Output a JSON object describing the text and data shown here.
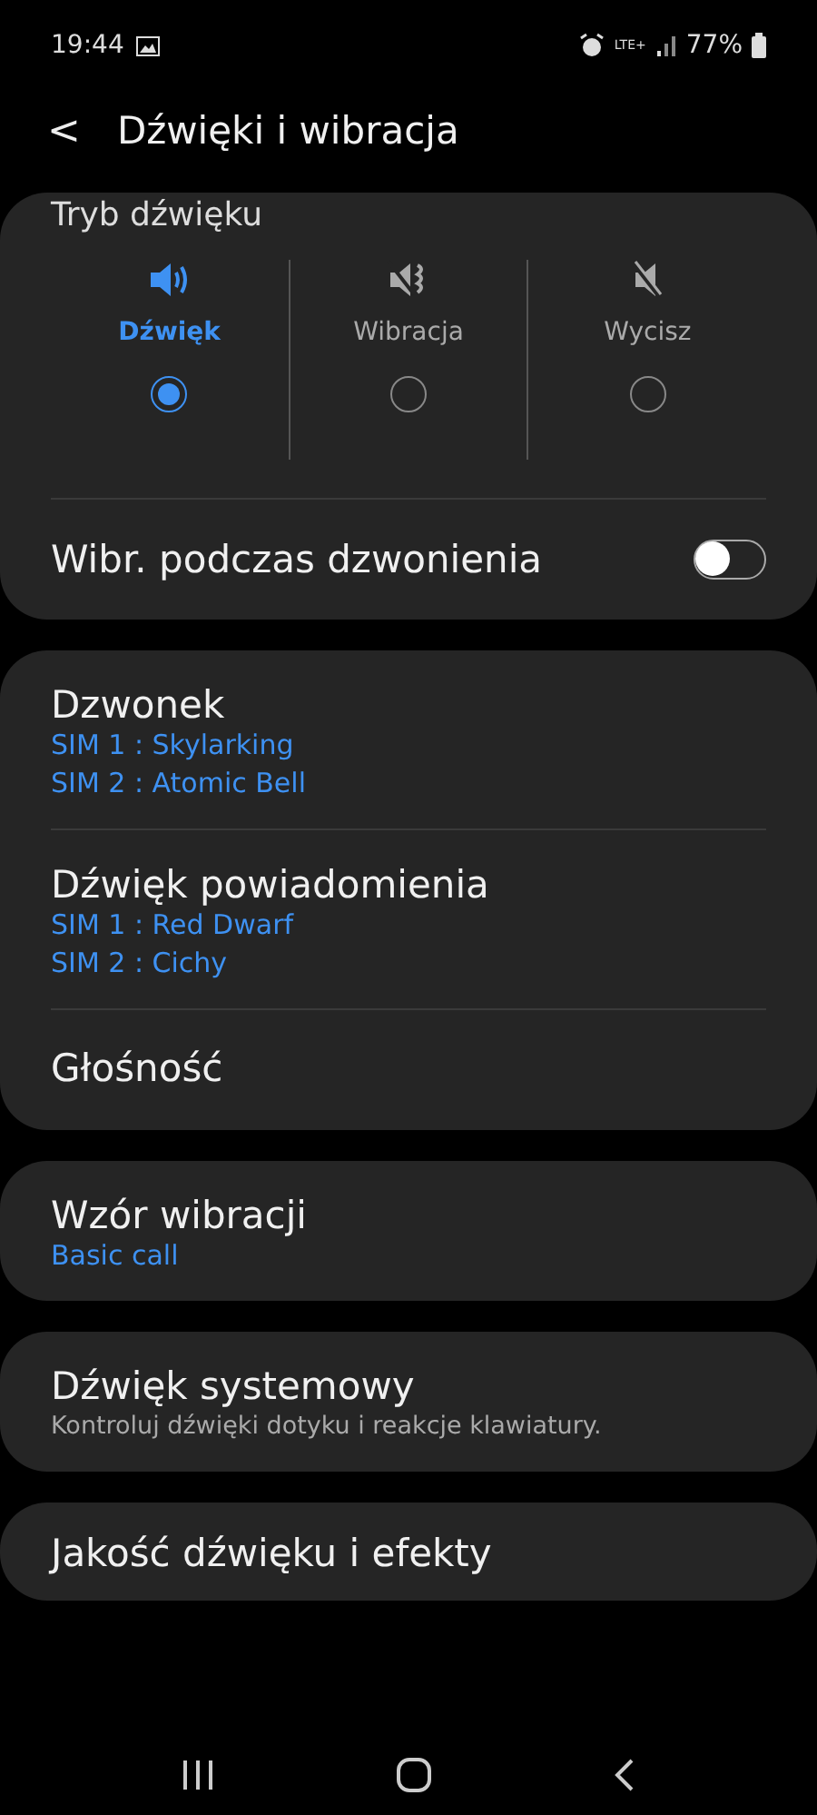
{
  "status_bar": {
    "time": "19:44",
    "network": "LTE+",
    "battery": "77%"
  },
  "header": {
    "back": "<",
    "title": "Dźwięki i wibracja"
  },
  "sound_mode": {
    "title": "Tryb dźwięku",
    "options": [
      {
        "kind": "sound",
        "label": "Dźwięk",
        "selected": true
      },
      {
        "kind": "vibrate",
        "label": "Wibracja",
        "selected": false
      },
      {
        "kind": "mute",
        "label": "Wycisz",
        "selected": false
      }
    ],
    "toggle": {
      "label": "Wibr. podczas dzwonienia",
      "on": false
    }
  },
  "groups": [
    [
      {
        "title": "Dzwonek",
        "values": [
          "SIM 1 : Skylarking",
          "SIM 2 : Atomic Bell"
        ]
      },
      {
        "title": "Dźwięk powiadomienia",
        "values": [
          "SIM 1 : Red Dwarf",
          "SIM 2 : Cichy"
        ]
      },
      {
        "title": "Głośność"
      }
    ],
    [
      {
        "title": "Wzór wibracji",
        "values": [
          "Basic call"
        ]
      }
    ],
    [
      {
        "title": "Dźwięk systemowy",
        "description": "Kontroluj dźwięki dotyku i reakcje klawiatury."
      }
    ],
    [
      {
        "title": "Jakość dźwięku i efekty"
      }
    ]
  ]
}
